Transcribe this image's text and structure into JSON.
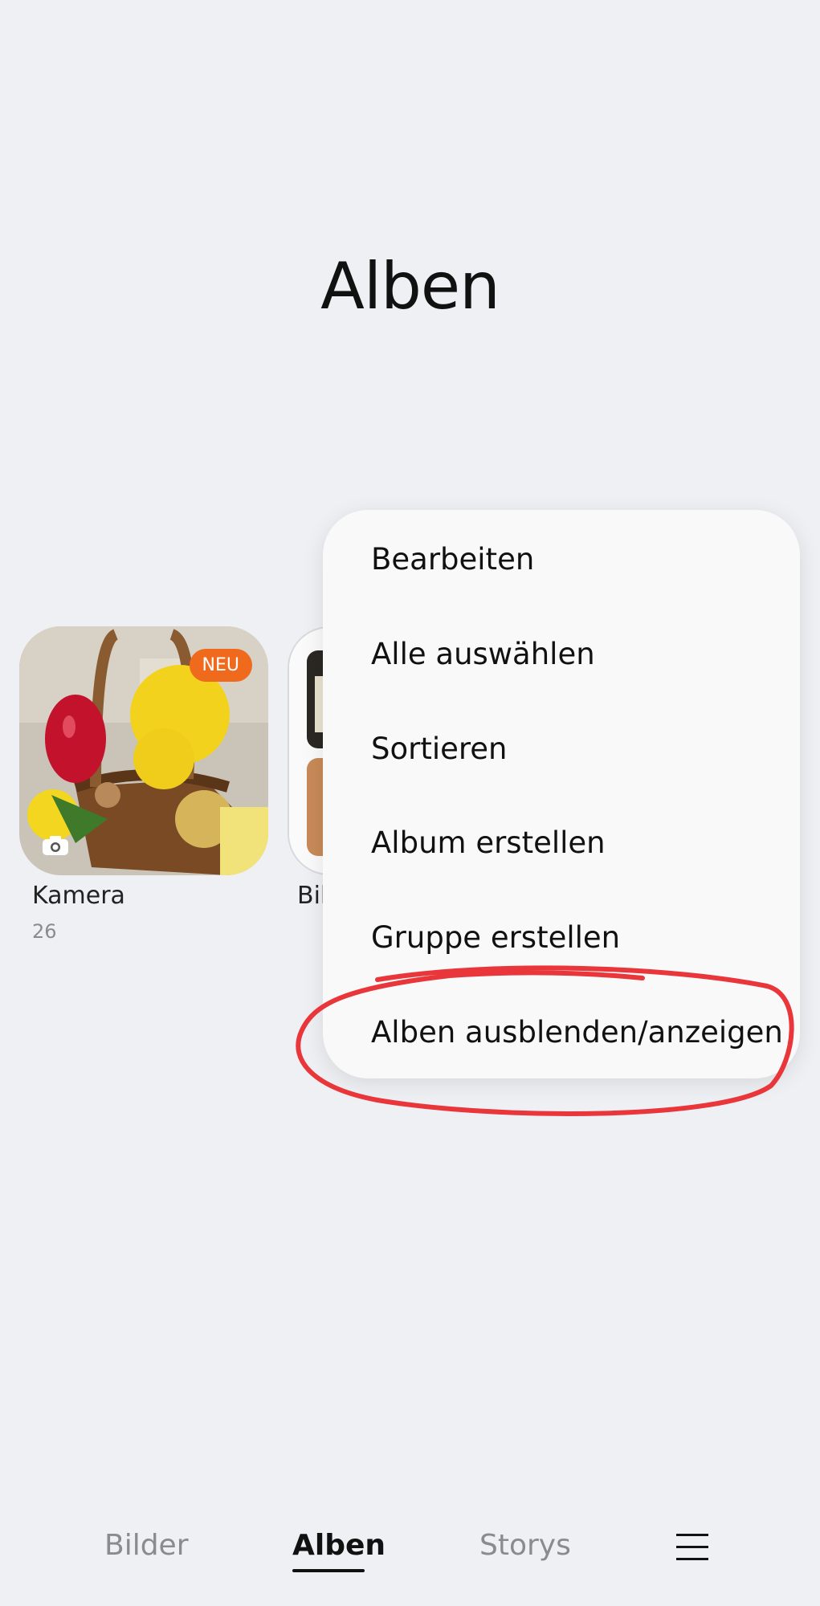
{
  "header": {
    "title": "Alben"
  },
  "albums": [
    {
      "name": "Kamera",
      "count": "26",
      "badge": "NEU",
      "icon": "camera-icon"
    },
    {
      "name": "Bil",
      "icon": "photo-collage"
    }
  ],
  "menu": {
    "items": [
      "Bearbeiten",
      "Alle auswählen",
      "Sortieren",
      "Album erstellen",
      "Gruppe erstellen",
      "Alben ausblenden/anzeigen"
    ],
    "highlight_color": "#e8363b"
  },
  "bottom_nav": {
    "tabs": [
      "Bilder",
      "Alben",
      "Storys"
    ],
    "active_tab": "Alben",
    "menu_icon": "hamburger-menu-icon"
  },
  "colors": {
    "background": "#eff0f4",
    "menu_background": "#f9f9f9",
    "badge": "#f06a1e"
  }
}
